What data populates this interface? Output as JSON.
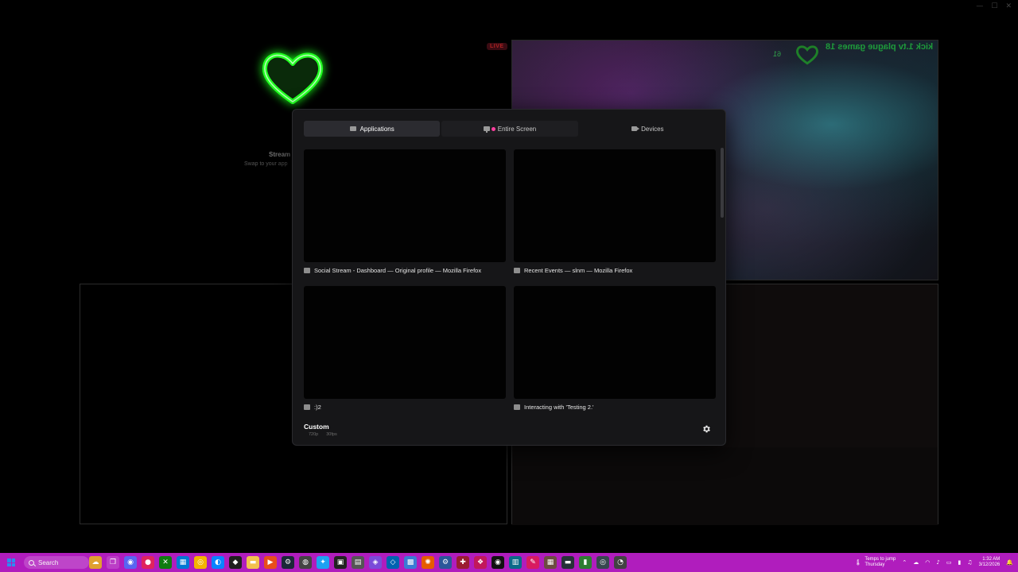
{
  "background": {
    "live_badge": "LIVE",
    "stream_title": "Stream",
    "stream_subtitle": "Swap to your app",
    "video_overlay": "kick 1.tv plague games 18",
    "video_overlay_small": "61"
  },
  "modal": {
    "tabs": [
      {
        "label": "Applications",
        "icon": "app-window-icon",
        "active": true
      },
      {
        "label": "Entire Screen",
        "icon": "monitor-icon",
        "active": false
      },
      {
        "label": "Devices",
        "icon": "camera-icon",
        "active": false
      }
    ],
    "sources": [
      {
        "label": "Social Stream - Dashboard — Original profile — Mozilla Firefox"
      },
      {
        "label": "Recent Events — slnm — Mozilla Firefox"
      },
      {
        "label": ":)2"
      },
      {
        "label": "Interacting with 'Testing 2.'"
      }
    ],
    "quality": {
      "title": "Custom",
      "resolution": "720p",
      "framerate": "30fps"
    }
  },
  "taskbar": {
    "search_label": "Search",
    "weather_line1": "Temps to jump",
    "weather_line2": "Thursday",
    "time": "1:32 AM",
    "date": "3/12/2026"
  }
}
